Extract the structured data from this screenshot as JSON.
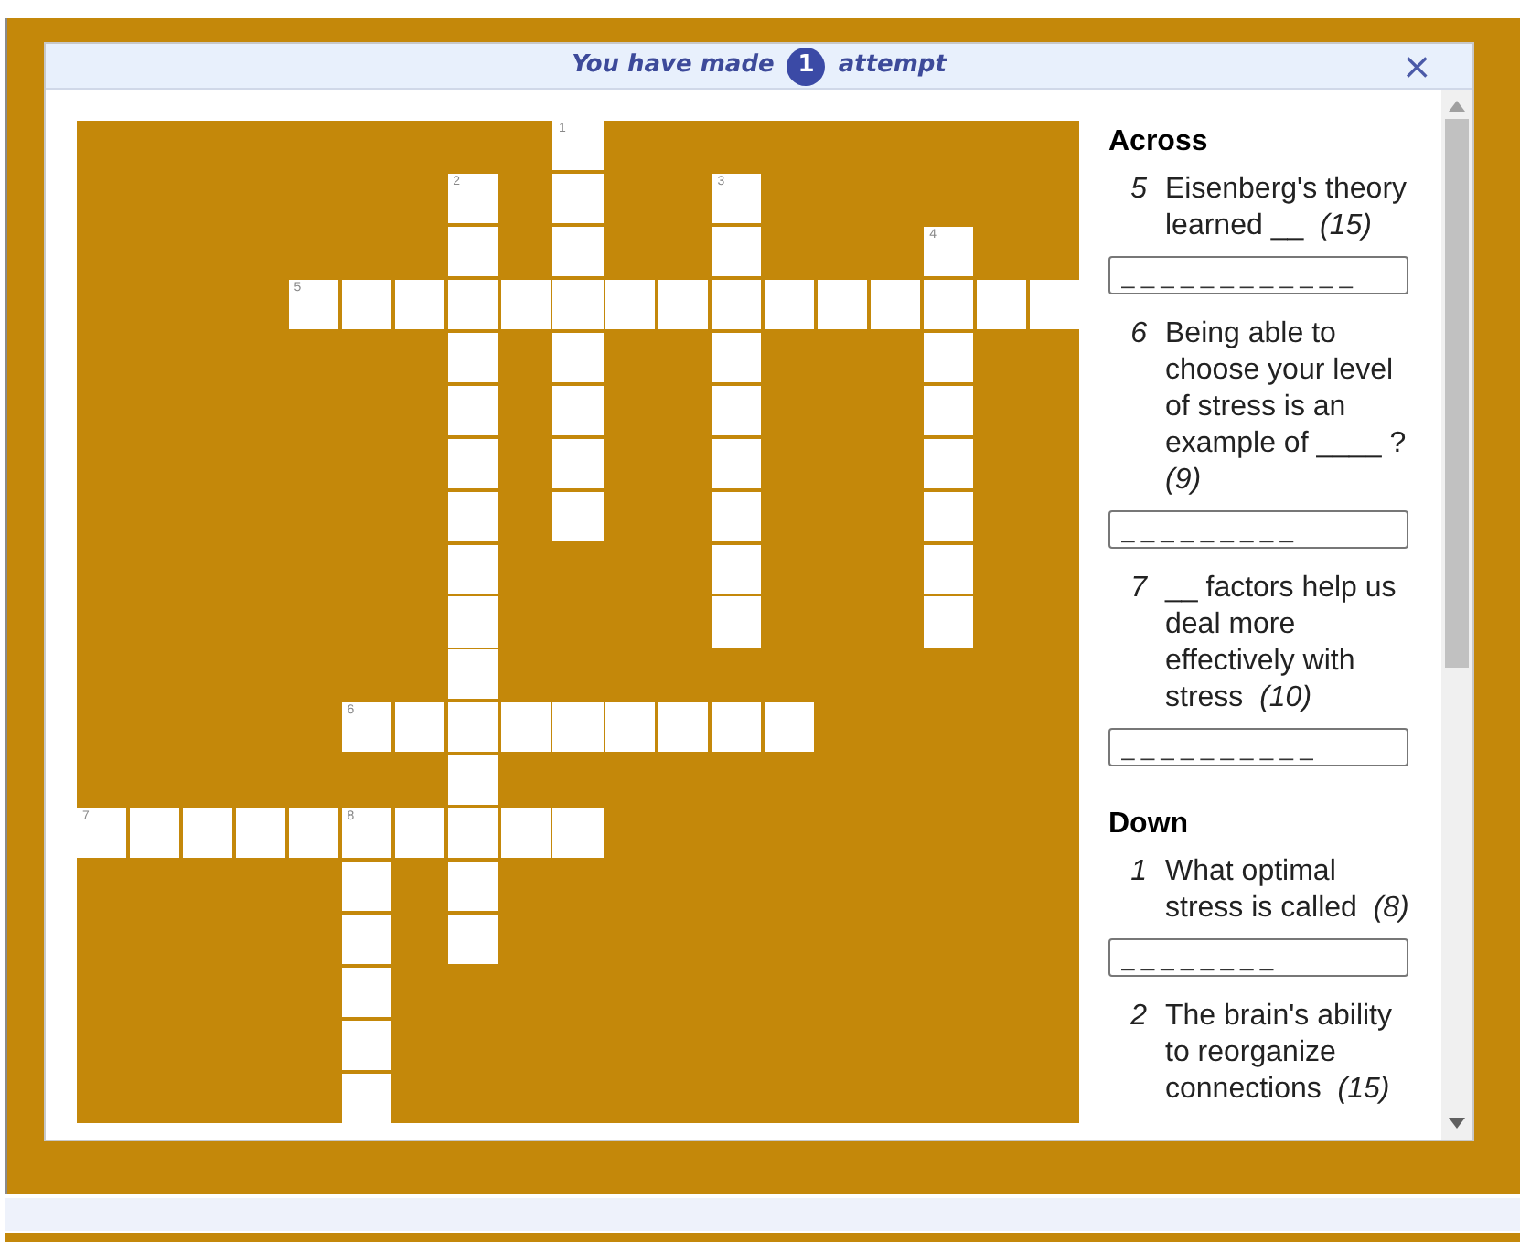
{
  "dialog": {
    "title_before": "You have made",
    "attempt_count": "1",
    "title_after": "attempt",
    "close": "×"
  },
  "grid": {
    "rows": [
      [
        {
          "kind": "block"
        },
        {
          "kind": "block"
        },
        {
          "kind": "block"
        },
        {
          "kind": "block"
        },
        {
          "kind": "block"
        },
        {
          "kind": "block"
        },
        {
          "kind": "block"
        },
        {
          "kind": "block"
        },
        {
          "kind": "block"
        },
        {
          "kind": "open",
          "number": "1"
        },
        {
          "kind": "block"
        },
        {
          "kind": "block"
        },
        {
          "kind": "block"
        },
        {
          "kind": "block"
        },
        {
          "kind": "block"
        },
        {
          "kind": "block"
        },
        {
          "kind": "block"
        },
        {
          "kind": "block"
        },
        {
          "kind": "block"
        }
      ],
      [
        {
          "kind": "block"
        },
        {
          "kind": "block"
        },
        {
          "kind": "block"
        },
        {
          "kind": "block"
        },
        {
          "kind": "block"
        },
        {
          "kind": "block"
        },
        {
          "kind": "block"
        },
        {
          "kind": "open",
          "number": "2"
        },
        {
          "kind": "block"
        },
        {
          "kind": "open"
        },
        {
          "kind": "block"
        },
        {
          "kind": "block"
        },
        {
          "kind": "open",
          "number": "3"
        },
        {
          "kind": "block"
        },
        {
          "kind": "block"
        },
        {
          "kind": "block"
        },
        {
          "kind": "block"
        },
        {
          "kind": "block"
        },
        {
          "kind": "block"
        }
      ],
      [
        {
          "kind": "block"
        },
        {
          "kind": "block"
        },
        {
          "kind": "block"
        },
        {
          "kind": "block"
        },
        {
          "kind": "block"
        },
        {
          "kind": "block"
        },
        {
          "kind": "block"
        },
        {
          "kind": "open"
        },
        {
          "kind": "block"
        },
        {
          "kind": "open"
        },
        {
          "kind": "block"
        },
        {
          "kind": "block"
        },
        {
          "kind": "open"
        },
        {
          "kind": "block"
        },
        {
          "kind": "block"
        },
        {
          "kind": "block"
        },
        {
          "kind": "open",
          "number": "4"
        },
        {
          "kind": "block"
        },
        {
          "kind": "block"
        }
      ],
      [
        {
          "kind": "block"
        },
        {
          "kind": "block"
        },
        {
          "kind": "block"
        },
        {
          "kind": "block"
        },
        {
          "kind": "open",
          "number": "5"
        },
        {
          "kind": "open"
        },
        {
          "kind": "open"
        },
        {
          "kind": "open"
        },
        {
          "kind": "open"
        },
        {
          "kind": "open"
        },
        {
          "kind": "open"
        },
        {
          "kind": "open"
        },
        {
          "kind": "open"
        },
        {
          "kind": "open"
        },
        {
          "kind": "open"
        },
        {
          "kind": "open"
        },
        {
          "kind": "open"
        },
        {
          "kind": "open"
        },
        {
          "kind": "open"
        }
      ],
      [
        {
          "kind": "block"
        },
        {
          "kind": "block"
        },
        {
          "kind": "block"
        },
        {
          "kind": "block"
        },
        {
          "kind": "block"
        },
        {
          "kind": "block"
        },
        {
          "kind": "block"
        },
        {
          "kind": "open"
        },
        {
          "kind": "block"
        },
        {
          "kind": "open"
        },
        {
          "kind": "block"
        },
        {
          "kind": "block"
        },
        {
          "kind": "open"
        },
        {
          "kind": "block"
        },
        {
          "kind": "block"
        },
        {
          "kind": "block"
        },
        {
          "kind": "open"
        },
        {
          "kind": "block"
        },
        {
          "kind": "block"
        }
      ],
      [
        {
          "kind": "block"
        },
        {
          "kind": "block"
        },
        {
          "kind": "block"
        },
        {
          "kind": "block"
        },
        {
          "kind": "block"
        },
        {
          "kind": "block"
        },
        {
          "kind": "block"
        },
        {
          "kind": "open"
        },
        {
          "kind": "block"
        },
        {
          "kind": "open"
        },
        {
          "kind": "block"
        },
        {
          "kind": "block"
        },
        {
          "kind": "open"
        },
        {
          "kind": "block"
        },
        {
          "kind": "block"
        },
        {
          "kind": "block"
        },
        {
          "kind": "open"
        },
        {
          "kind": "block"
        },
        {
          "kind": "block"
        }
      ],
      [
        {
          "kind": "block"
        },
        {
          "kind": "block"
        },
        {
          "kind": "block"
        },
        {
          "kind": "block"
        },
        {
          "kind": "block"
        },
        {
          "kind": "block"
        },
        {
          "kind": "block"
        },
        {
          "kind": "open"
        },
        {
          "kind": "block"
        },
        {
          "kind": "open"
        },
        {
          "kind": "block"
        },
        {
          "kind": "block"
        },
        {
          "kind": "open"
        },
        {
          "kind": "block"
        },
        {
          "kind": "block"
        },
        {
          "kind": "block"
        },
        {
          "kind": "open"
        },
        {
          "kind": "block"
        },
        {
          "kind": "block"
        }
      ],
      [
        {
          "kind": "block"
        },
        {
          "kind": "block"
        },
        {
          "kind": "block"
        },
        {
          "kind": "block"
        },
        {
          "kind": "block"
        },
        {
          "kind": "block"
        },
        {
          "kind": "block"
        },
        {
          "kind": "open"
        },
        {
          "kind": "block"
        },
        {
          "kind": "open"
        },
        {
          "kind": "block"
        },
        {
          "kind": "block"
        },
        {
          "kind": "open"
        },
        {
          "kind": "block"
        },
        {
          "kind": "block"
        },
        {
          "kind": "block"
        },
        {
          "kind": "open"
        },
        {
          "kind": "block"
        },
        {
          "kind": "block"
        }
      ],
      [
        {
          "kind": "block"
        },
        {
          "kind": "block"
        },
        {
          "kind": "block"
        },
        {
          "kind": "block"
        },
        {
          "kind": "block"
        },
        {
          "kind": "block"
        },
        {
          "kind": "block"
        },
        {
          "kind": "open"
        },
        {
          "kind": "block"
        },
        {
          "kind": "block"
        },
        {
          "kind": "block"
        },
        {
          "kind": "block"
        },
        {
          "kind": "open"
        },
        {
          "kind": "block"
        },
        {
          "kind": "block"
        },
        {
          "kind": "block"
        },
        {
          "kind": "open"
        },
        {
          "kind": "block"
        },
        {
          "kind": "block"
        }
      ],
      [
        {
          "kind": "block"
        },
        {
          "kind": "block"
        },
        {
          "kind": "block"
        },
        {
          "kind": "block"
        },
        {
          "kind": "block"
        },
        {
          "kind": "block"
        },
        {
          "kind": "block"
        },
        {
          "kind": "open"
        },
        {
          "kind": "block"
        },
        {
          "kind": "block"
        },
        {
          "kind": "block"
        },
        {
          "kind": "block"
        },
        {
          "kind": "open"
        },
        {
          "kind": "block"
        },
        {
          "kind": "block"
        },
        {
          "kind": "block"
        },
        {
          "kind": "open"
        },
        {
          "kind": "block"
        },
        {
          "kind": "block"
        }
      ],
      [
        {
          "kind": "block"
        },
        {
          "kind": "block"
        },
        {
          "kind": "block"
        },
        {
          "kind": "block"
        },
        {
          "kind": "block"
        },
        {
          "kind": "block"
        },
        {
          "kind": "block"
        },
        {
          "kind": "open"
        },
        {
          "kind": "block"
        },
        {
          "kind": "block"
        },
        {
          "kind": "block"
        },
        {
          "kind": "block"
        },
        {
          "kind": "block"
        },
        {
          "kind": "block"
        },
        {
          "kind": "block"
        },
        {
          "kind": "block"
        },
        {
          "kind": "block"
        },
        {
          "kind": "block"
        },
        {
          "kind": "block"
        }
      ],
      [
        {
          "kind": "block"
        },
        {
          "kind": "block"
        },
        {
          "kind": "block"
        },
        {
          "kind": "block"
        },
        {
          "kind": "block"
        },
        {
          "kind": "open",
          "number": "6"
        },
        {
          "kind": "open"
        },
        {
          "kind": "open"
        },
        {
          "kind": "open"
        },
        {
          "kind": "open"
        },
        {
          "kind": "open"
        },
        {
          "kind": "open"
        },
        {
          "kind": "open"
        },
        {
          "kind": "open"
        },
        {
          "kind": "block"
        },
        {
          "kind": "block"
        },
        {
          "kind": "block"
        },
        {
          "kind": "block"
        },
        {
          "kind": "block"
        }
      ],
      [
        {
          "kind": "block"
        },
        {
          "kind": "block"
        },
        {
          "kind": "block"
        },
        {
          "kind": "block"
        },
        {
          "kind": "block"
        },
        {
          "kind": "block"
        },
        {
          "kind": "block"
        },
        {
          "kind": "open"
        },
        {
          "kind": "block"
        },
        {
          "kind": "block"
        },
        {
          "kind": "block"
        },
        {
          "kind": "block"
        },
        {
          "kind": "block"
        },
        {
          "kind": "block"
        },
        {
          "kind": "block"
        },
        {
          "kind": "block"
        },
        {
          "kind": "block"
        },
        {
          "kind": "block"
        },
        {
          "kind": "block"
        }
      ],
      [
        {
          "kind": "open",
          "number": "7"
        },
        {
          "kind": "open"
        },
        {
          "kind": "open"
        },
        {
          "kind": "open"
        },
        {
          "kind": "open"
        },
        {
          "kind": "open",
          "number": "8"
        },
        {
          "kind": "open"
        },
        {
          "kind": "open"
        },
        {
          "kind": "open"
        },
        {
          "kind": "open"
        },
        {
          "kind": "block"
        },
        {
          "kind": "block"
        },
        {
          "kind": "block"
        },
        {
          "kind": "block"
        },
        {
          "kind": "block"
        },
        {
          "kind": "block"
        },
        {
          "kind": "block"
        },
        {
          "kind": "block"
        },
        {
          "kind": "block"
        }
      ],
      [
        {
          "kind": "block"
        },
        {
          "kind": "block"
        },
        {
          "kind": "block"
        },
        {
          "kind": "block"
        },
        {
          "kind": "block"
        },
        {
          "kind": "open"
        },
        {
          "kind": "block"
        },
        {
          "kind": "open"
        },
        {
          "kind": "block"
        },
        {
          "kind": "block"
        },
        {
          "kind": "block"
        },
        {
          "kind": "block"
        },
        {
          "kind": "block"
        },
        {
          "kind": "block"
        },
        {
          "kind": "block"
        },
        {
          "kind": "block"
        },
        {
          "kind": "block"
        },
        {
          "kind": "block"
        },
        {
          "kind": "block"
        }
      ],
      [
        {
          "kind": "block"
        },
        {
          "kind": "block"
        },
        {
          "kind": "block"
        },
        {
          "kind": "block"
        },
        {
          "kind": "block"
        },
        {
          "kind": "open"
        },
        {
          "kind": "block"
        },
        {
          "kind": "open"
        },
        {
          "kind": "block"
        },
        {
          "kind": "block"
        },
        {
          "kind": "block"
        },
        {
          "kind": "block"
        },
        {
          "kind": "block"
        },
        {
          "kind": "block"
        },
        {
          "kind": "block"
        },
        {
          "kind": "block"
        },
        {
          "kind": "block"
        },
        {
          "kind": "block"
        },
        {
          "kind": "block"
        }
      ],
      [
        {
          "kind": "block"
        },
        {
          "kind": "block"
        },
        {
          "kind": "block"
        },
        {
          "kind": "block"
        },
        {
          "kind": "block"
        },
        {
          "kind": "open"
        },
        {
          "kind": "block"
        },
        {
          "kind": "block"
        },
        {
          "kind": "block"
        },
        {
          "kind": "block"
        },
        {
          "kind": "block"
        },
        {
          "kind": "block"
        },
        {
          "kind": "block"
        },
        {
          "kind": "block"
        },
        {
          "kind": "block"
        },
        {
          "kind": "block"
        },
        {
          "kind": "block"
        },
        {
          "kind": "block"
        },
        {
          "kind": "block"
        }
      ],
      [
        {
          "kind": "block"
        },
        {
          "kind": "block"
        },
        {
          "kind": "block"
        },
        {
          "kind": "block"
        },
        {
          "kind": "block"
        },
        {
          "kind": "open"
        },
        {
          "kind": "block"
        },
        {
          "kind": "block"
        },
        {
          "kind": "block"
        },
        {
          "kind": "block"
        },
        {
          "kind": "block"
        },
        {
          "kind": "block"
        },
        {
          "kind": "block"
        },
        {
          "kind": "block"
        },
        {
          "kind": "block"
        },
        {
          "kind": "block"
        },
        {
          "kind": "block"
        },
        {
          "kind": "block"
        },
        {
          "kind": "block"
        }
      ],
      [
        {
          "kind": "block"
        },
        {
          "kind": "block"
        },
        {
          "kind": "block"
        },
        {
          "kind": "block"
        },
        {
          "kind": "block"
        },
        {
          "kind": "open"
        },
        {
          "kind": "block"
        },
        {
          "kind": "block"
        },
        {
          "kind": "block"
        },
        {
          "kind": "block"
        },
        {
          "kind": "block"
        },
        {
          "kind": "block"
        },
        {
          "kind": "block"
        },
        {
          "kind": "block"
        },
        {
          "kind": "block"
        },
        {
          "kind": "block"
        },
        {
          "kind": "block"
        },
        {
          "kind": "block"
        },
        {
          "kind": "block"
        }
      ]
    ]
  },
  "clue_sections": [
    {
      "heading": "Across",
      "clues": [
        {
          "number": "5",
          "text": "Eisenberg's theory learned __  *(15)*",
          "placeholder": "_ _ _ _ _ _ _ _ _ _ _ _"
        },
        {
          "number": "6",
          "text": "Being able to choose your level of stress is an example of ____ ?  *(9)*",
          "placeholder": "_ _ _ _ _ _ _ _ _"
        },
        {
          "number": "7",
          "text": "__ factors help us deal more effectively with stress  *(10)*",
          "placeholder": "_ _ _ _ _ _ _ _ _ _"
        }
      ]
    },
    {
      "heading": "Down",
      "clues": [
        {
          "number": "1",
          "text": "What optimal stress is called  *(8)*",
          "placeholder": "_ _ _ _ _ _ _ _"
        },
        {
          "number": "2",
          "text": "The brain's ability to reorganize connections  *(15)*"
        }
      ]
    }
  ]
}
